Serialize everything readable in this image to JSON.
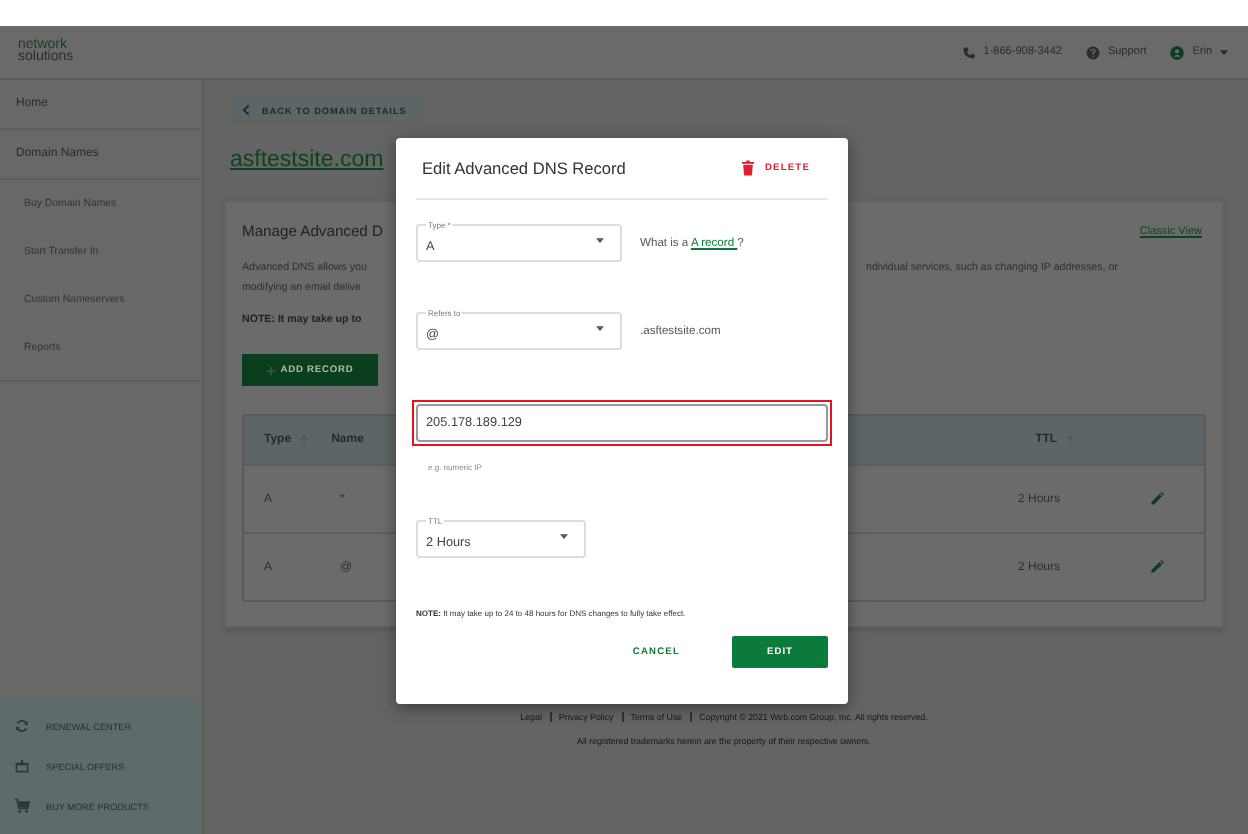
{
  "header": {
    "logo_top": "network",
    "logo_bottom": "solutions",
    "phone": "1-866-908-3442",
    "support": "Support",
    "user": "Erin"
  },
  "sidebar": {
    "items": [
      {
        "label": "Home"
      },
      {
        "label": "Domain Names",
        "children": [
          {
            "label": "Buy Domain Names"
          },
          {
            "label": "Start Transfer In"
          },
          {
            "label": "Custom Nameservers"
          },
          {
            "label": "Reports"
          }
        ]
      }
    ],
    "footer_items": [
      {
        "kind": "renew",
        "label": "RENEWAL CENTER"
      },
      {
        "kind": "gift",
        "label": "SPECIAL OFFERS"
      },
      {
        "kind": "cart",
        "label": "BUY MORE PRODUCTS"
      }
    ]
  },
  "main": {
    "back_button": "BACK TO DOMAIN DETAILS",
    "domain": "asftestsite.com",
    "card": {
      "title": "Manage Advanced D",
      "classic_view": "Classic View",
      "lines": [
        {
          "left": "Advanced DNS allows you",
          "right": "ndividual services, such as changing IP addresses, or"
        },
        {
          "left": "modifying an email delive"
        }
      ],
      "note": "NOTE: It may take up to",
      "add_record": "ADD RECORD",
      "table": {
        "columns": [
          "Type",
          "Name",
          "TTL"
        ],
        "rows": [
          {
            "type": "A",
            "name": "*",
            "ttl": "2 Hours"
          },
          {
            "type": "A",
            "name": "@",
            "ttl": "2 Hours"
          }
        ]
      }
    }
  },
  "footer": {
    "links": [
      "Legal",
      "Privacy Policy",
      "Terms of Use"
    ],
    "copyright": "Copyright © 2021 Web.com Group, Inc. All rights reserved.",
    "trademarks": "All registered trademarks herein are the property of their respective owners."
  },
  "dialog": {
    "title": "Edit Advanced DNS Record",
    "delete": "DELETE",
    "type_field": {
      "label": "Type *",
      "value": "A"
    },
    "help": {
      "prefix": "What is a",
      "link": "A record ",
      "suffix": "?"
    },
    "refers_field": {
      "label": "Refers to",
      "value": "@"
    },
    "suffix": ".asftestsite.com",
    "ip_field": {
      "value": "205.178.189.129",
      "highlighted": true
    },
    "hint": "e.g. numeric IP",
    "ttl_field": {
      "label": "TTL",
      "value": "2 Hours"
    },
    "note": "**NOTE:** It may take up to 24 to 48 hours for DNS changes to fully take effect.",
    "cancel": "CANCEL",
    "edit": "EDIT"
  }
}
